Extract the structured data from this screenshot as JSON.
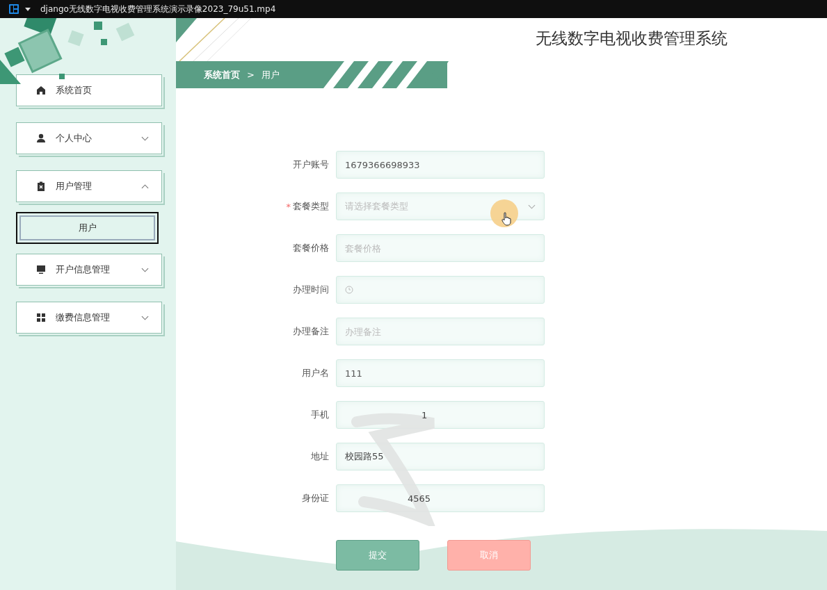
{
  "window": {
    "title": "django无线数字电视收费管理系统演示录像2023_79u51.mp4"
  },
  "header": {
    "title": "无线数字电视收费管理系统"
  },
  "breadcrumb": [
    {
      "label": "系统首页"
    },
    {
      "label": ">"
    },
    {
      "label": "用户"
    }
  ],
  "sidebar": {
    "items": [
      {
        "kind": "link",
        "label": "系统首页"
      },
      {
        "kind": "group",
        "label": "个人中心",
        "expanded": false
      },
      {
        "kind": "group",
        "label": "用户管理",
        "expanded": true,
        "children": [
          {
            "label": "用户",
            "selected": true
          }
        ]
      },
      {
        "kind": "group",
        "label": "开户信息管理",
        "expanded": false
      },
      {
        "kind": "group",
        "label": "缴费信息管理",
        "expanded": false
      }
    ]
  },
  "form": {
    "fields": [
      {
        "kind": "text",
        "label": "开户账号",
        "value": "1679366698933"
      },
      {
        "kind": "select",
        "label": "套餐类型",
        "required_mark": "*",
        "placeholder": "请选择套餐类型"
      },
      {
        "kind": "text",
        "label": "套餐价格",
        "placeholder": "套餐价格"
      },
      {
        "kind": "date",
        "label": "办理时间"
      },
      {
        "kind": "text",
        "label": "办理备注",
        "placeholder": "办理备注"
      },
      {
        "kind": "text",
        "label": "用户名",
        "value": "111"
      },
      {
        "kind": "redacted",
        "label": "手机",
        "value": "1"
      },
      {
        "kind": "redacted",
        "label": "地址",
        "value": "校园路55"
      },
      {
        "kind": "redacted",
        "label": "身份证",
        "value": "4565"
      }
    ],
    "buttons": [
      {
        "kind": "submit",
        "label": "提交"
      },
      {
        "kind": "cancel",
        "label": "取消"
      }
    ]
  }
}
